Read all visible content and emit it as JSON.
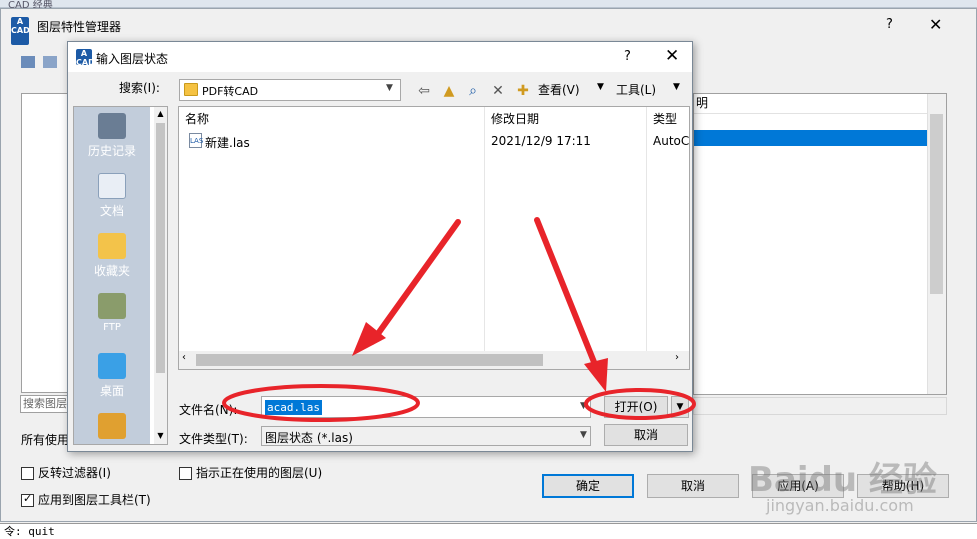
{
  "background_strip": {
    "text": "CAD 经典"
  },
  "layer_manager": {
    "title": "图层特性管理器",
    "help_label": "?",
    "close_label": "✕",
    "search_placeholder": "搜索图层",
    "all_used_label": "所有使用",
    "right_header": "明",
    "options": {
      "invert_filter": "反转过滤器(I)",
      "indicate_in_use": "指示正在使用的图层(U)",
      "apply_to_toolbar": "应用到图层工具栏(T)"
    },
    "buttons": {
      "ok": "确定",
      "cancel": "取消",
      "apply": "应用(A)",
      "help": "帮助(H)"
    }
  },
  "command_line": {
    "text": "令:  quit"
  },
  "dialog": {
    "title": "输入图层状态",
    "help_label": "?",
    "close_label": "✕",
    "search_label": "搜索(I):",
    "look_in": "PDF转CAD",
    "toolbar": {
      "view_label": "查看(V)",
      "tools_label": "工具(L)"
    },
    "places": [
      {
        "label": "历史记录",
        "icon": "history-icon"
      },
      {
        "label": "文档",
        "icon": "documents-icon"
      },
      {
        "label": "收藏夹",
        "icon": "favorites-icon"
      },
      {
        "label": "FTP",
        "icon": "ftp-icon"
      },
      {
        "label": "桌面",
        "icon": "desktop-icon"
      }
    ],
    "columns": {
      "name": "名称",
      "date": "修改日期",
      "type": "类型"
    },
    "files": [
      {
        "name": "新建.las",
        "date": "2021/12/9 17:11",
        "type": "AutoC"
      }
    ],
    "filename_label": "文件名(N):",
    "filename_value": "acad.las",
    "filetype_label": "文件类型(T):",
    "filetype_value": "图层状态 (*.las)",
    "open_label": "打开(O)",
    "cancel_label": "取消"
  },
  "watermark": {
    "logo": "Baidu 经验",
    "sub": "jingyan.baidu.com"
  },
  "colors": {
    "selection": "#0078d7",
    "annotation_red": "#e8242a",
    "places_bar": "#c2cddb"
  }
}
